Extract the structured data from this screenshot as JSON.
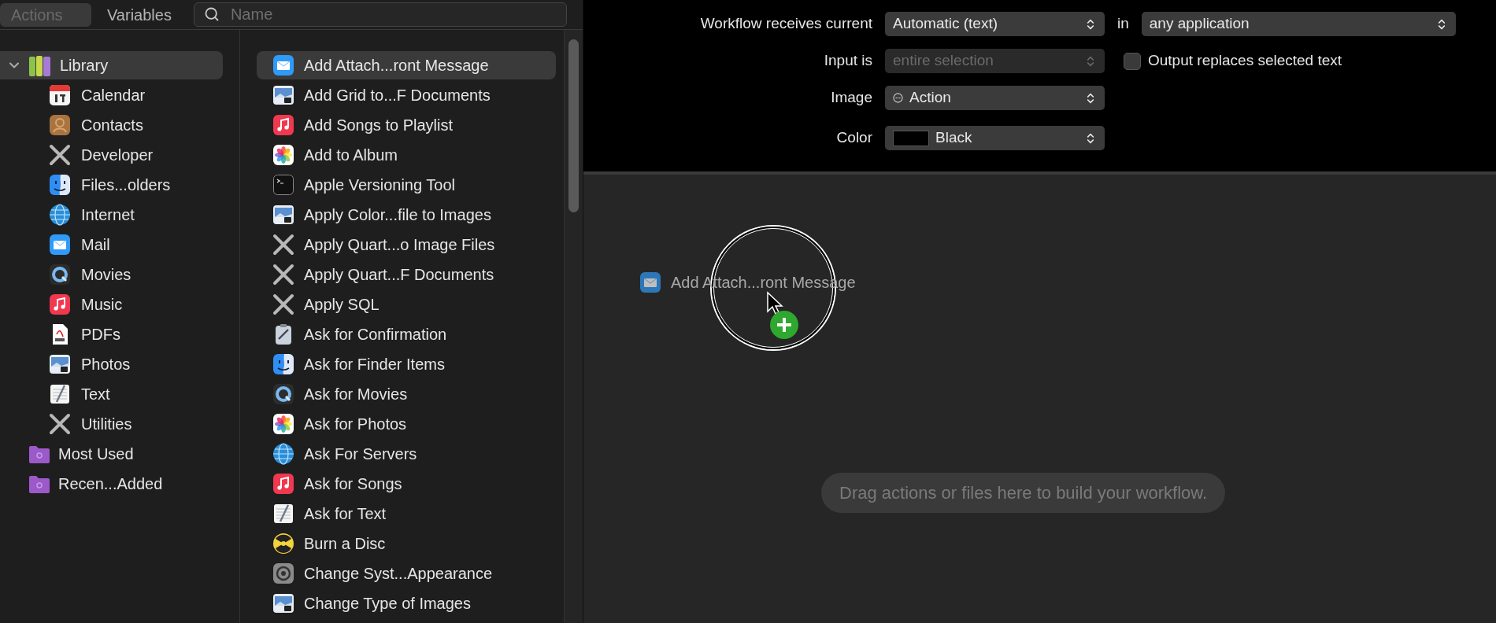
{
  "tabs": [
    {
      "label": "Actions",
      "selected": true
    },
    {
      "label": "Variables",
      "selected": false
    }
  ],
  "search": {
    "placeholder": "Name"
  },
  "library": [
    {
      "label": "Library",
      "kind": "library",
      "selected": true,
      "expanded": true,
      "children": [
        {
          "label": "Calendar",
          "kind": "calendar"
        },
        {
          "label": "Contacts",
          "kind": "contacts"
        },
        {
          "label": "Developer",
          "kind": "tools"
        },
        {
          "label": "Files...olders",
          "kind": "finder"
        },
        {
          "label": "Internet",
          "kind": "globe"
        },
        {
          "label": "Mail",
          "kind": "mail"
        },
        {
          "label": "Movies",
          "kind": "movies"
        },
        {
          "label": "Music",
          "kind": "music"
        },
        {
          "label": "PDFs",
          "kind": "pdf"
        },
        {
          "label": "Photos",
          "kind": "preview"
        },
        {
          "label": "Text",
          "kind": "text"
        },
        {
          "label": "Utilities",
          "kind": "tools"
        }
      ]
    },
    {
      "label": "Most Used",
      "kind": "folder",
      "selected": false
    },
    {
      "label": "Recen...Added",
      "kind": "folder",
      "selected": false
    }
  ],
  "actions": [
    {
      "label": "Add Attach...ront Message",
      "kind": "mail",
      "selected": true
    },
    {
      "label": "Add Grid to...F Documents",
      "kind": "preview",
      "selected": false
    },
    {
      "label": "Add Songs to Playlist",
      "kind": "music",
      "selected": false
    },
    {
      "label": "Add to Album",
      "kind": "photos",
      "selected": false
    },
    {
      "label": "Apple Versioning Tool",
      "kind": "terminal",
      "selected": false
    },
    {
      "label": "Apply Color...file to Images",
      "kind": "preview",
      "selected": false
    },
    {
      "label": "Apply Quart...o Image Files",
      "kind": "tools",
      "selected": false
    },
    {
      "label": "Apply Quart...F Documents",
      "kind": "tools",
      "selected": false
    },
    {
      "label": "Apply SQL",
      "kind": "tools",
      "selected": false
    },
    {
      "label": "Ask for Confirmation",
      "kind": "confirm",
      "selected": false
    },
    {
      "label": "Ask for Finder Items",
      "kind": "finder",
      "selected": false
    },
    {
      "label": "Ask for Movies",
      "kind": "movies",
      "selected": false
    },
    {
      "label": "Ask for Photos",
      "kind": "photos",
      "selected": false
    },
    {
      "label": "Ask For Servers",
      "kind": "globe",
      "selected": false
    },
    {
      "label": "Ask for Songs",
      "kind": "music",
      "selected": false
    },
    {
      "label": "Ask for Text",
      "kind": "text",
      "selected": false
    },
    {
      "label": "Burn a Disc",
      "kind": "burn",
      "selected": false
    },
    {
      "label": "Change Syst...Appearance",
      "kind": "settings",
      "selected": false
    },
    {
      "label": "Change Type of Images",
      "kind": "preview",
      "selected": false
    }
  ],
  "workflow_settings": {
    "receives_label": "Workflow receives current",
    "receives_value": "Automatic (text)",
    "in_label": "in",
    "application_value": "any application",
    "input_label": "Input is",
    "input_value": "entire selection",
    "input_disabled": true,
    "output_checkbox": {
      "label": "Output replaces selected text",
      "checked": false
    },
    "image_label": "Image",
    "image_value": "Action",
    "color_label": "Color",
    "color_value": "Black",
    "color": "#000000"
  },
  "drag_preview": {
    "label": "Add Attach...ront Message"
  },
  "canvas_hint": "Drag actions or files here to build your workflow."
}
